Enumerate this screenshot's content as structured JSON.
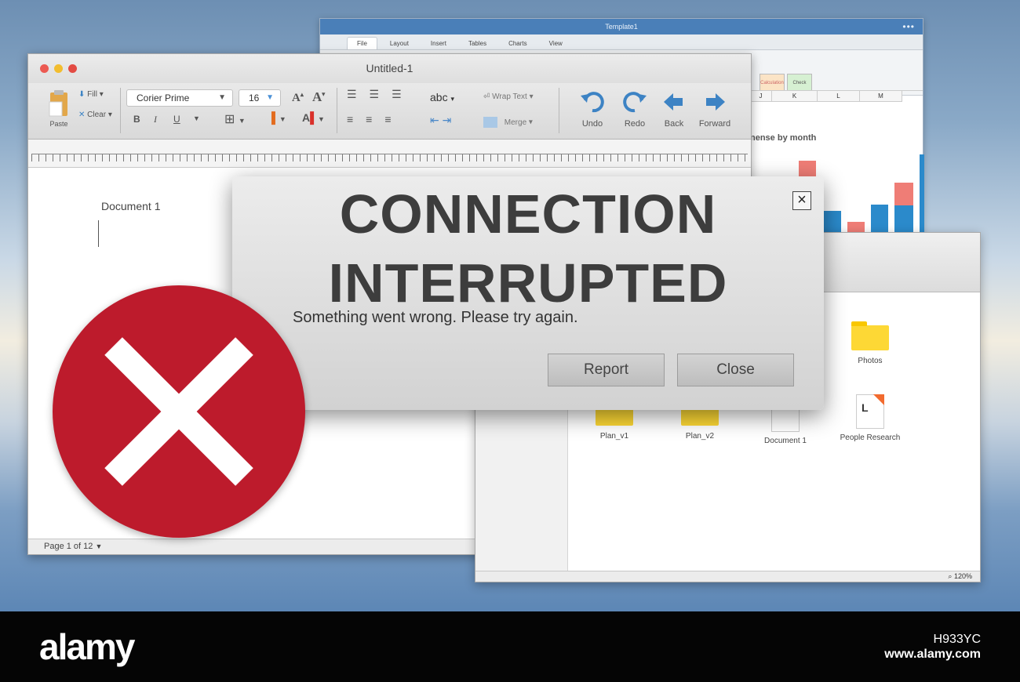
{
  "spreadsheet": {
    "title": "Template1",
    "tabs": [
      "File",
      "Layout",
      "Insert",
      "Tables",
      "Charts",
      "View"
    ],
    "ribbon_styles": [
      "Calculation",
      "Check"
    ],
    "columns": [
      "J",
      "K",
      "L",
      "M"
    ],
    "chart_title": "nense by month",
    "bar_colors": {
      "primary": "#2b8acb",
      "secondary": "#ef7d76"
    }
  },
  "document": {
    "title": "Untitled-1",
    "toolbar": {
      "paste_label": "Paste",
      "fill_label": "Fill",
      "clear_label": "Clear",
      "font_name": "Corier Prime",
      "font_size": "16",
      "spell_label": "abc",
      "wrap_label": "Wrap Text",
      "merge_label": "Merge",
      "undo_label": "Undo",
      "redo_label": "Redo",
      "back_label": "Back",
      "forward_label": "Forward"
    },
    "heading": "Document 1",
    "page_status": "Page 1 of 12"
  },
  "file_browser": {
    "items": [
      {
        "name": "Photos",
        "kind": "folder"
      },
      {
        "name": "Plan_v1",
        "kind": "folder"
      },
      {
        "name": "Plan_v2",
        "kind": "folder"
      },
      {
        "name": "Document 1",
        "kind": "document"
      },
      {
        "name": "People Research",
        "kind": "document"
      }
    ],
    "zoom": "120%"
  },
  "dialog": {
    "title_line1": "CONNECTION",
    "title_line2": "INTERRUPTED",
    "message": "Something went wrong. Please try again.",
    "report_label": "Report",
    "close_label": "Close",
    "close_icon": "×"
  },
  "error_badge": {
    "icon": "close-x-icon",
    "color": "#bd1b2c"
  },
  "footer": {
    "brand": "alamy",
    "image_id": "H933YC",
    "url": "www.alamy.com"
  }
}
